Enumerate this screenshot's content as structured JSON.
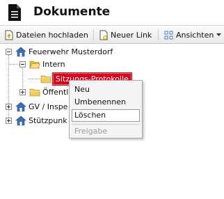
{
  "header": {
    "title": "Dokumente"
  },
  "toolbar": {
    "upload_label": "Dateien hochladen",
    "new_link_label": "Neuer Link",
    "views_label": "Ansichten"
  },
  "tree": {
    "root": "Feuerwehr Musterdorf",
    "intern": "Intern",
    "selected": "Sitzungs-Protokolle",
    "public": "Öffentl",
    "gv": "GV / Inspe",
    "stuetzpunkt": "Stützpunk"
  },
  "context_menu": {
    "new": "Neu",
    "rename": "Umbenennen",
    "delete": "Löschen",
    "share": "Freigabe"
  },
  "colors": {
    "selection": "#d9011b",
    "home_icon": "#3a6fb5",
    "folder": "#f2cd5c"
  }
}
